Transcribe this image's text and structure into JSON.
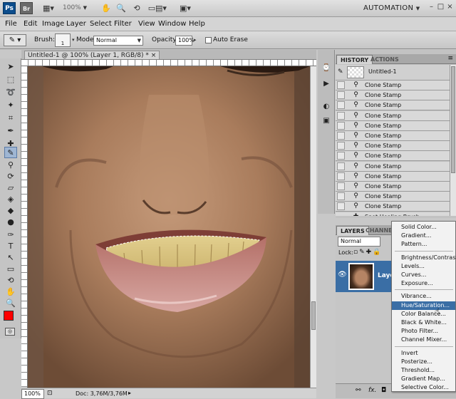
{
  "app": {
    "logo": "Ps",
    "bridge": "Br",
    "zoom": "100%",
    "workspace": "AUTOMATION"
  },
  "menu": [
    "File",
    "Edit",
    "Image",
    "Layer",
    "Select",
    "Filter",
    "View",
    "Window",
    "Help"
  ],
  "options": {
    "brush_label": "Brush:",
    "brush_size": "1",
    "mode_label": "Mode:",
    "mode_value": "Normal",
    "opacity_label": "Opacity:",
    "opacity_value": "100%",
    "auto_erase_label": "Auto Erase"
  },
  "document": {
    "tab_title": "Untitled-1 @ 100% (Layer 1, RGB/8) *",
    "close": "×"
  },
  "status": {
    "zoom": "100%",
    "doc_size": "Doc: 3,76M/3,76M"
  },
  "history": {
    "tabs": [
      "HISTORY",
      "ACTIONS"
    ],
    "snapshot": "Untitled-1",
    "items": [
      "Clone Stamp",
      "Clone Stamp",
      "Clone Stamp",
      "Clone Stamp",
      "Clone Stamp",
      "Clone Stamp",
      "Clone Stamp",
      "Clone Stamp",
      "Clone Stamp",
      "Clone Stamp",
      "Clone Stamp",
      "Clone Stamp",
      "Clone Stamp"
    ],
    "partial": "Spot Healing Brush"
  },
  "layers": {
    "tabs": [
      "LAYERS",
      "CHANNELS"
    ],
    "blend_mode": "Normal",
    "lock_label": "Lock:",
    "layer_name": "Laye"
  },
  "adjustments_menu": {
    "group1": [
      "Solid Color...",
      "Gradient...",
      "Pattern..."
    ],
    "group2": [
      "Brightness/Contrast...",
      "Levels...",
      "Curves...",
      "Exposure..."
    ],
    "group3": [
      "Vibrance...",
      "Hue/Saturation...",
      "Color Balance...",
      "Black & White...",
      "Photo Filter...",
      "Channel Mixer..."
    ],
    "group4": [
      "Invert",
      "Posterize...",
      "Threshold...",
      "Gradient Map...",
      "Selective Color..."
    ],
    "highlighted": "Hue/Saturation..."
  },
  "colors": {
    "foreground": "#ff0000",
    "background": "#ffffff",
    "selection": "#3a6ea5"
  },
  "icons": {
    "hand": "hand-icon",
    "zoom": "zoom-icon",
    "rotate": "rotate-view-icon"
  }
}
